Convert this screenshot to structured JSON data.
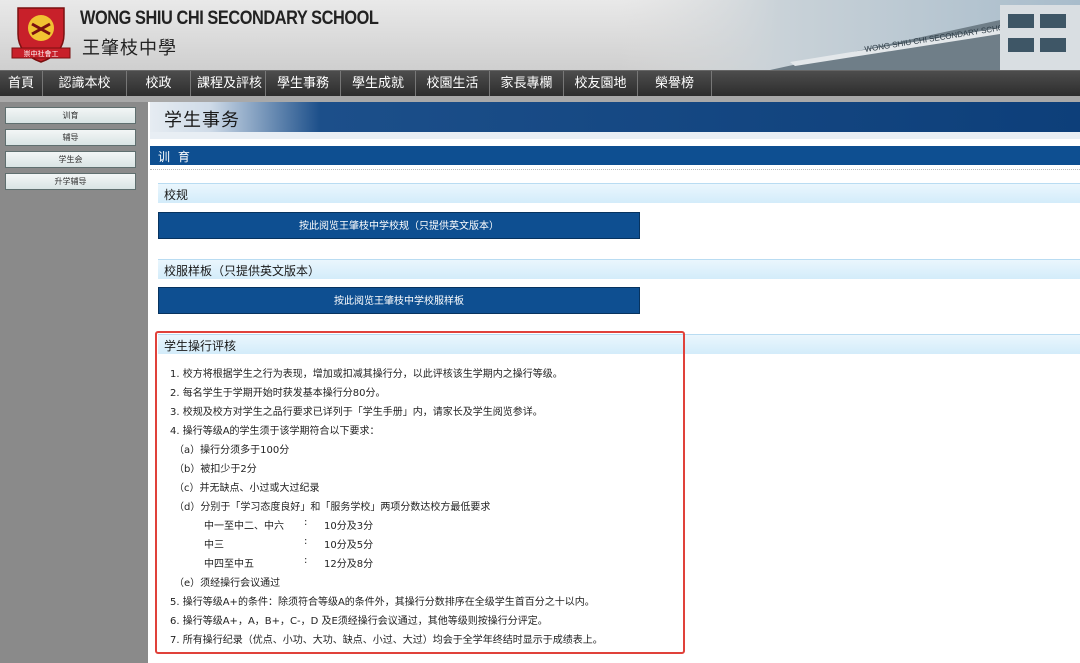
{
  "header": {
    "school_en": "WONG SHIU CHI SECONDARY SCHOOL",
    "school_zh": "王肇枝中學",
    "crest_motto": "崇中社會工",
    "photo_sign": "WONG SHIU CHI SECONDARY SCHOOL"
  },
  "nav": [
    "首頁",
    "認識本校",
    "校政",
    "課程及評核",
    "學生事務",
    "學生成就",
    "校園生活",
    "家長專欄",
    "校友園地",
    "榮譽榜"
  ],
  "sidebar": {
    "items": [
      "训育",
      "辅导",
      "学生会",
      "升学辅导"
    ]
  },
  "main": {
    "page_title": "学生事务",
    "section_title": "训 育",
    "rules_head": "校规",
    "rules_link": "按此阅览王肇枝中学校规（只提供英文版本）",
    "uniform_head": "校服样板（只提供英文版本）",
    "uniform_link": "按此阅览王肇枝中学校服样板",
    "conduct_head": "学生操行评核",
    "conduct": {
      "r1": "1. 校方将根据学生之行为表现，增加或扣减其操行分，以此评核该生学期内之操行等级。",
      "r2": "2. 每名学生于学期开始时获发基本操行分80分。",
      "r3": "3. 校规及校方对学生之品行要求已详列于「学生手册」内，请家长及学生阅览参详。",
      "r4": "4. 操行等级A的学生须于该学期符合以下要求：",
      "a": "（a）操行分须多于100分",
      "b": "（b）被扣少于2分",
      "c": "（c）并无缺点、小过或大过纪录",
      "d": "（d）分别于「学习态度良好」和「服务学校」两项分数达校方最低要求",
      "g1_label": "中一至中二、中六",
      "g1_sep": ":",
      "g1_value": "10分及3分",
      "g2_label": "中三",
      "g2_sep": ":",
      "g2_value": "10分及5分",
      "g3_label": "中四至中五",
      "g3_sep": ":",
      "g3_value": "12分及8分",
      "e": "（e）须经操行会议通过",
      "r5": "5. 操行等级A+的条件：除须符合等级A的条件外，其操行分数排序在全级学生首百分之十以内。",
      "r6": "6. 操行等级A+，A，B+，C-，D 及E须经操行会议通过，其他等级则按操行分评定。",
      "r7": "7. 所有操行纪录（优点、小功、大功、缺点、小过、大过）均会于全学年终结时显示于成绩表上。"
    }
  },
  "colors": {
    "nav_bg": "#3a3a3a",
    "primary_blue": "#0e4f91",
    "sub_head_bg": "#dbeffb",
    "highlight": "#e0413a",
    "sidebar_bg": "#8a8a8a"
  }
}
